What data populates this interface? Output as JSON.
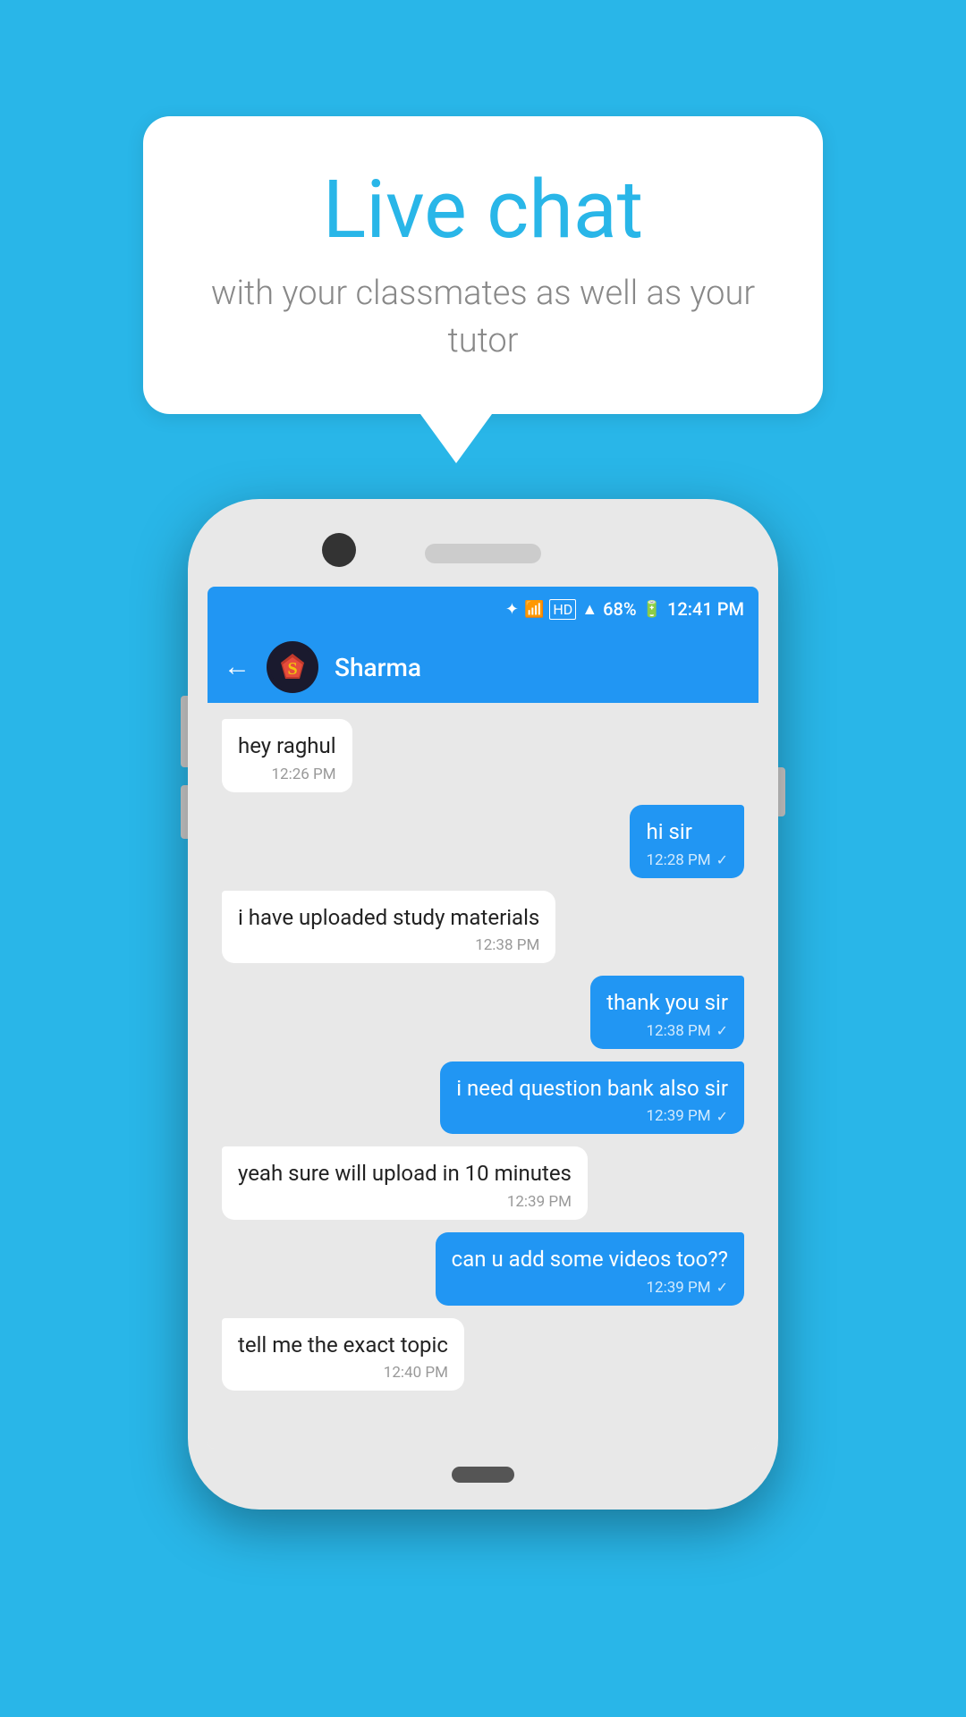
{
  "background_color": "#29b6e8",
  "speech_bubble": {
    "title": "Live chat",
    "subtitle": "with your classmates as well as your tutor"
  },
  "phone": {
    "status_bar": {
      "time": "12:41 PM",
      "battery": "68%"
    },
    "chat_header": {
      "contact_name": "Sharma",
      "back_label": "←"
    },
    "messages": [
      {
        "id": 1,
        "type": "received",
        "text": "hey raghul",
        "time": "12:26 PM",
        "check": false
      },
      {
        "id": 2,
        "type": "sent",
        "text": "hi sir",
        "time": "12:28 PM",
        "check": true
      },
      {
        "id": 3,
        "type": "received",
        "text": "i have uploaded study materials",
        "time": "12:38 PM",
        "check": false
      },
      {
        "id": 4,
        "type": "sent",
        "text": "thank you sir",
        "time": "12:38 PM",
        "check": true
      },
      {
        "id": 5,
        "type": "sent",
        "text": "i need question bank also sir",
        "time": "12:39 PM",
        "check": true
      },
      {
        "id": 6,
        "type": "received",
        "text": "yeah sure will upload in 10 minutes",
        "time": "12:39 PM",
        "check": false
      },
      {
        "id": 7,
        "type": "sent",
        "text": "can u add some videos too??",
        "time": "12:39 PM",
        "check": true
      },
      {
        "id": 8,
        "type": "received",
        "text": "tell me the exact topic",
        "time": "12:40 PM",
        "check": false
      }
    ]
  }
}
